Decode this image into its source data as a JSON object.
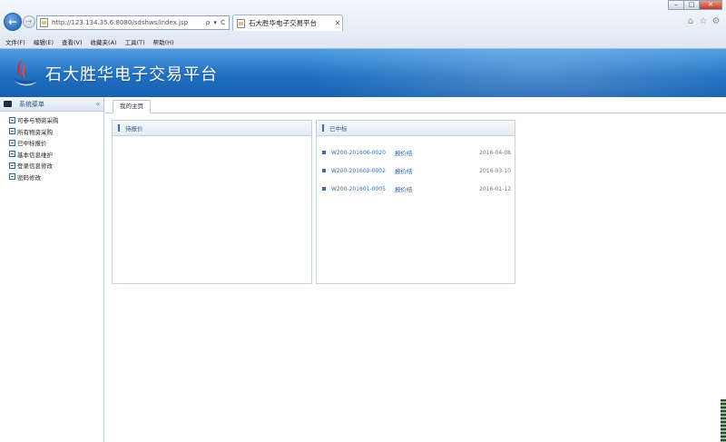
{
  "browser": {
    "url": "http://123.134.35.6:8080/sdshws/index.jsp",
    "address_icons": "ρ ▾ C",
    "tab_title": "石大胜华电子交易平台",
    "tab_close": "✕",
    "window_buttons": [
      "–",
      "□",
      "✕"
    ],
    "menu": [
      "文件(F)",
      "编辑(E)",
      "查看(V)",
      "收藏夹(A)",
      "工具(T)",
      "帮助(H)"
    ]
  },
  "header": {
    "title": "石大胜华电子交易平台",
    "colors": {
      "top": "#4f9ee3",
      "bottom": "#1761b0",
      "logo_red": "#d62b2b",
      "logo_blue": "#1a4fa0"
    }
  },
  "sidebar": {
    "title": "系统菜单",
    "collapse": "«",
    "items": [
      {
        "label": "可参与物资采购"
      },
      {
        "label": "所有物资采购"
      },
      {
        "label": "已中标报价"
      },
      {
        "label": "基本信息维护"
      },
      {
        "label": "登录信息修改"
      },
      {
        "label": "密码修改"
      }
    ]
  },
  "content": {
    "tab": "我的主页",
    "left_panel": {
      "title": "待报价",
      "rows": []
    },
    "right_panel": {
      "title": "已中标",
      "rows": [
        {
          "code": "W200-201606-0020",
          "status": "报价结",
          "date": "2016-04-08"
        },
        {
          "code": "W200-201603-0002",
          "status": "报价结",
          "date": "2016-03-10"
        },
        {
          "code": "W200-201601-0005",
          "status": "报价结",
          "date": "2016-01-12"
        }
      ]
    }
  }
}
